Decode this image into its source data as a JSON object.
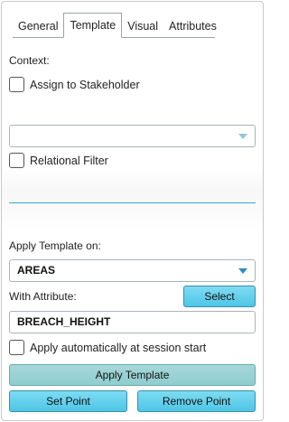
{
  "tabs": [
    "General",
    "Template",
    "Visual",
    "Attributes"
  ],
  "active_tab": "Template",
  "context_label": "Context:",
  "assign_label": "Assign to Stakeholder",
  "stakeholder_dropdown": {
    "value": ""
  },
  "relational_filter_label": "Relational Filter",
  "apply_template_on_label": "Apply Template on:",
  "target_dropdown": {
    "value": "AREAS"
  },
  "with_attribute_label": "With Attribute:",
  "select_button": "Select",
  "attribute_field": {
    "value": "BREACH_HEIGHT"
  },
  "apply_automatically_label": "Apply automatically at session start",
  "apply_template_button": "Apply Template",
  "set_point_button": "Set Point",
  "remove_point_button": "Remove Point",
  "colors": {
    "accent": "#4ec6e6",
    "caret": "#2a8fc8",
    "underline": "#3aa9cf"
  }
}
